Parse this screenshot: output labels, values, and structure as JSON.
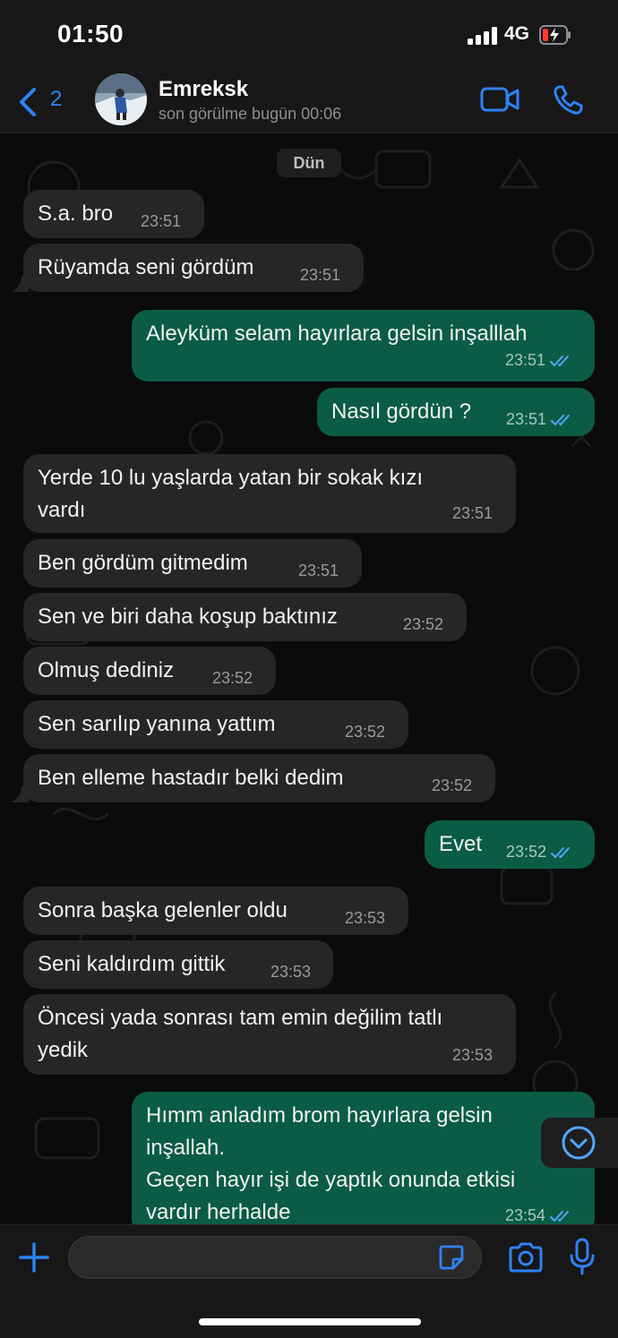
{
  "status_bar": {
    "time": "01:50",
    "network": "4G"
  },
  "header": {
    "back_count": "2",
    "contact_name": "Emreksk",
    "last_seen": "son görülme bugün 00:06"
  },
  "chat": {
    "date_label": "Dün",
    "messages": [
      {
        "dir": "in",
        "text": "S.a. bro",
        "time": "23:51"
      },
      {
        "dir": "in",
        "text": "Rüyamda seni gördüm",
        "time": "23:51"
      },
      {
        "dir": "out",
        "text": "Aleyküm selam hayırlara gelsin inşalllah",
        "time": "23:51",
        "read": true
      },
      {
        "dir": "out",
        "text": "Nasıl gördün ?",
        "time": "23:51",
        "read": true
      },
      {
        "dir": "in",
        "text": "Yerde 10 lu yaşlarda yatan bir sokak kızı\nvardı",
        "time": "23:51"
      },
      {
        "dir": "in",
        "text": "Ben gördüm gitmedim",
        "time": "23:51"
      },
      {
        "dir": "in",
        "text": "Sen ve biri daha koşup baktınız",
        "time": "23:52"
      },
      {
        "dir": "in",
        "text": "Olmuş dediniz",
        "time": "23:52"
      },
      {
        "dir": "in",
        "text": "Sen sarılıp yanına yattım",
        "time": "23:52"
      },
      {
        "dir": "in",
        "text": "Ben elleme hastadır belki dedim",
        "time": "23:52"
      },
      {
        "dir": "out",
        "text": "Evet",
        "time": "23:52",
        "read": true
      },
      {
        "dir": "in",
        "text": "Sonra başka gelenler oldu",
        "time": "23:53"
      },
      {
        "dir": "in",
        "text": "Seni kaldırdım gittik",
        "time": "23:53"
      },
      {
        "dir": "in",
        "text": "Öncesi yada sonrası tam emin değilim tatlı\nyedik",
        "time": "23:53"
      },
      {
        "dir": "out",
        "text": "Hımm anladım brom hayırlara gelsin\ninşallah.\nGeçen hayır işi de yaptık onunda etkisi\nvardır herhalde",
        "time": "23:54",
        "read": true
      }
    ]
  },
  "composer": {
    "placeholder": ""
  },
  "colors": {
    "accent": "#2f82f5",
    "outgoing_bubble": "#0b5c45",
    "incoming_bubble": "#262628",
    "read_tick": "#53a6ff"
  },
  "icons": [
    "back-chevron-icon",
    "video-call-icon",
    "phone-call-icon",
    "plus-icon",
    "sticker-icon",
    "camera-icon",
    "microphone-icon",
    "chevron-down-icon"
  ]
}
